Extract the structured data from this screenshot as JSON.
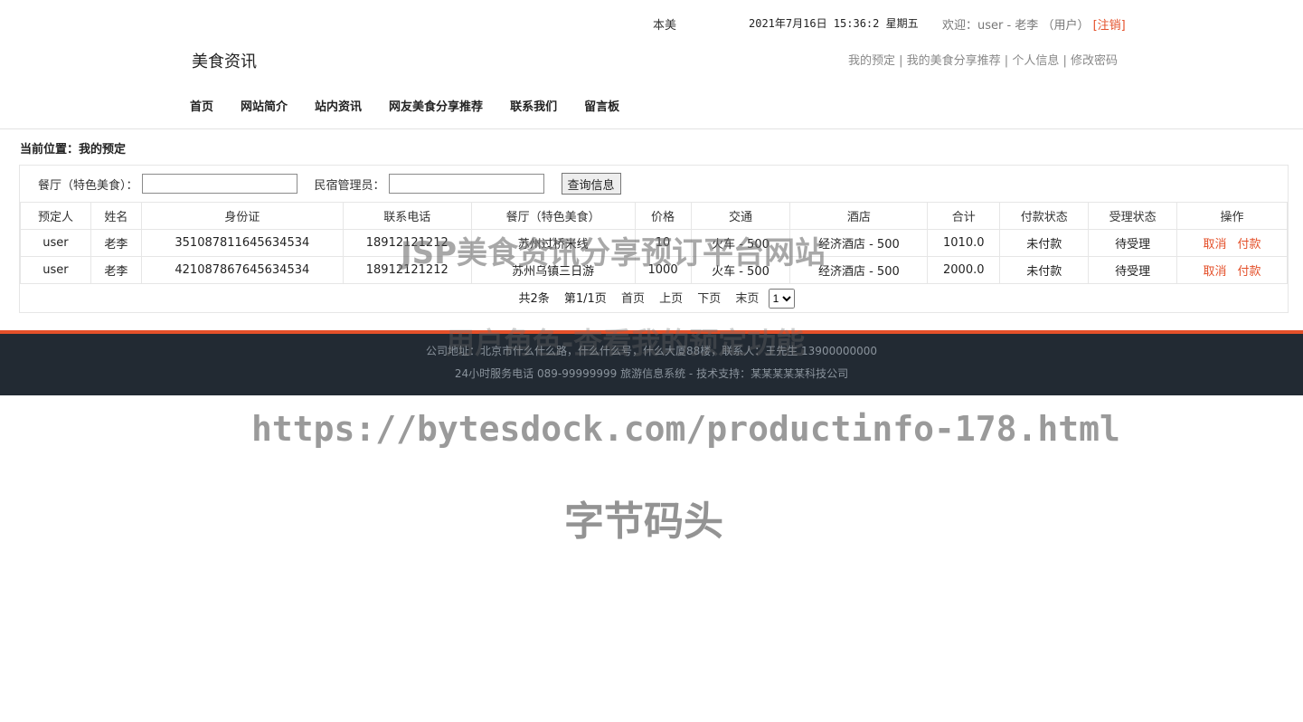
{
  "top": {
    "marquee": "本美",
    "clock": "2021年7月16日 15:36:2 星期五",
    "welcome": "欢迎：user - 老李 （用户）",
    "logout": "[注销]"
  },
  "brand": "美食资讯",
  "user_links": [
    "我的预定",
    "我的美食分享推荐",
    "个人信息",
    "修改密码"
  ],
  "nav": [
    "首页",
    "网站简介",
    "站内资讯",
    "网友美食分享推荐",
    "联系我们",
    "留言板"
  ],
  "breadcrumb": "当前位置：我的预定",
  "search": {
    "restaurant_label": "餐厅（特色美食）：",
    "restaurant_value": "",
    "manager_label": "民宿管理员：",
    "manager_value": "",
    "button": "查询信息"
  },
  "table": {
    "headers": [
      "预定人",
      "姓名",
      "身份证",
      "联系电话",
      "餐厅（特色美食）",
      "价格",
      "交通",
      "酒店",
      "合计",
      "付款状态",
      "受理状态",
      "操作"
    ],
    "rows": [
      {
        "booker": "user",
        "name": "老李",
        "id_card": "351087811645634534",
        "phone": "18912121212",
        "restaurant": "苏州过桥米线",
        "price": "10",
        "transport": "火车 - 500",
        "hotel": "经济酒店 - 500",
        "total": "1010.0",
        "pay_status": "未付款",
        "accept_status": "待受理",
        "cancel": "取消",
        "pay": "付款"
      },
      {
        "booker": "user",
        "name": "老李",
        "id_card": "421087867645634534",
        "phone": "18912121212",
        "restaurant": "苏州乌镇三日游",
        "price": "1000",
        "transport": "火车 - 500",
        "hotel": "经济酒店 - 500",
        "total": "2000.0",
        "pay_status": "未付款",
        "accept_status": "待受理",
        "cancel": "取消",
        "pay": "付款"
      }
    ]
  },
  "pager": {
    "total": "共2条",
    "page_info": "第1/1页",
    "first": "首页",
    "prev": "上页",
    "next": "下页",
    "last": "末页",
    "selected_page": "1"
  },
  "footer": {
    "line1": "公司地址：北京市什么什么路，什么什么号，什么大厦88楼，联系人：王先生 13900000000",
    "line2": "24小时服务电话   089-99999999   旅游信息系统 - 技术支持：某某某某某科技公司"
  },
  "watermarks": {
    "title": "JSP美食资讯分享预订平台网站",
    "subtitle": "用户角色-查看我的预定功能",
    "url": "https://bytesdock.com/productinfo-178.html",
    "brand": "字节码头"
  },
  "colors": {
    "accent": "#e4502a",
    "footer_bg": "#222a33"
  }
}
